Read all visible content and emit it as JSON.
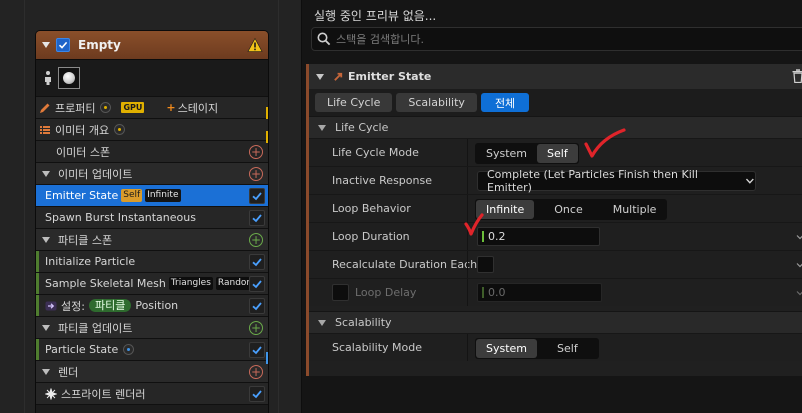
{
  "graph": {
    "node": {
      "title": "Empty",
      "enabled": true,
      "properties_label": "프로퍼티",
      "gpu_label": "GPU",
      "stage_label": "스테이지",
      "summary_label": "이미터 개요",
      "sections": {
        "emitter_spawn": "이미터 스폰",
        "emitter_update": "이미터 업데이트",
        "particle_spawn": "파티클 스폰",
        "particle_update": "파티클 업데이트",
        "render": "렌더"
      },
      "modules": {
        "emitter_state": {
          "label": "Emitter State",
          "badge1": "Self",
          "badge2": "Infinite"
        },
        "spawn_burst": {
          "label": "Spawn Burst Instantaneous"
        },
        "initialize_particle": {
          "label": "Initialize Particle"
        },
        "sample_skeletal_mesh": {
          "label": "Sample Skeletal Mesh",
          "badge1": "Triangles",
          "badge2": "Random"
        },
        "set_position": {
          "prefix": "설정:",
          "badge": "파티클",
          "suffix": "Position"
        },
        "particle_state": {
          "label": "Particle State"
        },
        "sprite_renderer": {
          "label": "스프라이트 렌더러"
        }
      }
    }
  },
  "details": {
    "preview_text": "실행 중인 프리뷰 없음...",
    "search": {
      "placeholder": "스택을 검색합니다."
    },
    "category_title": "Emitter State",
    "tabs": [
      "Life Cycle",
      "Scalability",
      "전체"
    ],
    "active_tab": "전체",
    "life_cycle": {
      "header": "Life Cycle",
      "mode": {
        "label": "Life Cycle Mode",
        "options": [
          "System",
          "Self"
        ],
        "selected": "Self"
      },
      "inactive_response": {
        "label": "Inactive Response",
        "value": "Complete (Let Particles Finish then Kill Emitter)"
      },
      "loop_behavior": {
        "label": "Loop Behavior",
        "options": [
          "Infinite",
          "Once",
          "Multiple"
        ],
        "selected": "Infinite"
      },
      "loop_duration": {
        "label": "Loop Duration",
        "value": "0.2"
      },
      "recalc_duration": {
        "label": "Recalculate Duration Each"
      },
      "loop_delay": {
        "label": "Loop Delay",
        "value": "0.0"
      }
    },
    "scalability": {
      "header": "Scalability",
      "mode": {
        "label": "Scalability Mode",
        "options": [
          "System",
          "Self"
        ],
        "selected": "System"
      }
    }
  },
  "colors": {
    "accent_blue": "#1b70d6",
    "emitter_orange": "#8b4a2b",
    "annotation_red": "#e0242a"
  }
}
